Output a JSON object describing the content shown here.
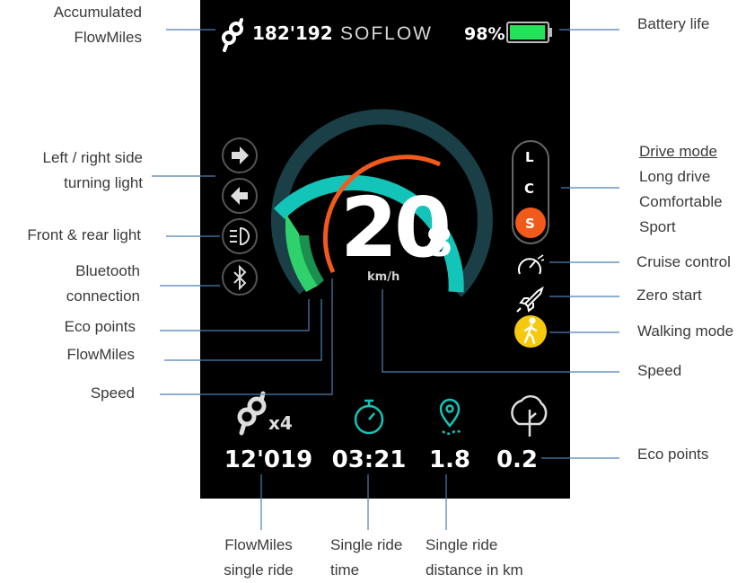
{
  "colors": {
    "screen_bg": "#000000",
    "teal": "#12c5b8",
    "dark_teal": "#1a3f46",
    "orange": "#f25a1c",
    "green": "#2ed16b",
    "battery_green": "#27e05a",
    "walk_yellow": "#f6c90e",
    "leader_line": "#4e7fb5"
  },
  "icons": {
    "flowmiles": "flowmiles-logo-icon",
    "battery": "battery-icon",
    "turn_right": "arrow-right-icon",
    "turn_left": "arrow-left-icon",
    "headlight": "headlight-icon",
    "bluetooth": "bluetooth-icon",
    "cruise": "speedometer-icon",
    "zero_start": "rocket-icon",
    "walking": "walking-person-icon",
    "stopwatch": "stopwatch-icon",
    "location": "location-pin-icon",
    "tree": "tree-icon"
  },
  "display": {
    "flowmiles_total": "182'192",
    "brand": "SOFLOW",
    "battery_percent": "98%",
    "battery_level": 0.98,
    "speed_int": "20",
    "speed_dec": ".8",
    "speed_unit": "km/h",
    "mode_l": "L",
    "mode_c": "C",
    "mode_s": "S",
    "multiplier": "x4",
    "stat_flowmiles": "12'019",
    "stat_time": "03:21",
    "stat_distance": "1.8",
    "stat_eco": "0.2"
  },
  "labels": {
    "accumulated_1": "Accumulated",
    "accumulated_2": "FlowMiles",
    "turning_1": "Left / right side",
    "turning_2": "turning light",
    "front_rear": "Front & rear light",
    "bluetooth_1": "Bluetooth",
    "bluetooth_2": "connection",
    "eco_points_left": "Eco points",
    "flowmiles_left": "FlowMiles",
    "speed_left": "Speed",
    "battery_life": "Battery life",
    "drive_mode_title": "Drive mode",
    "long_drive": "Long drive",
    "comfortable": "Comfortable",
    "sport": "Sport",
    "cruise_control": "Cruise control",
    "zero_start": "Zero start",
    "walking_mode": "Walking mode",
    "speed_right": "Speed",
    "eco_points_right": "Eco points",
    "flowmiles_single_1": "FlowMiles",
    "flowmiles_single_2": "single ride",
    "ride_time_1": "Single ride",
    "ride_time_2": "time",
    "ride_distance_1": "Single ride",
    "ride_distance_2": "distance in km"
  }
}
